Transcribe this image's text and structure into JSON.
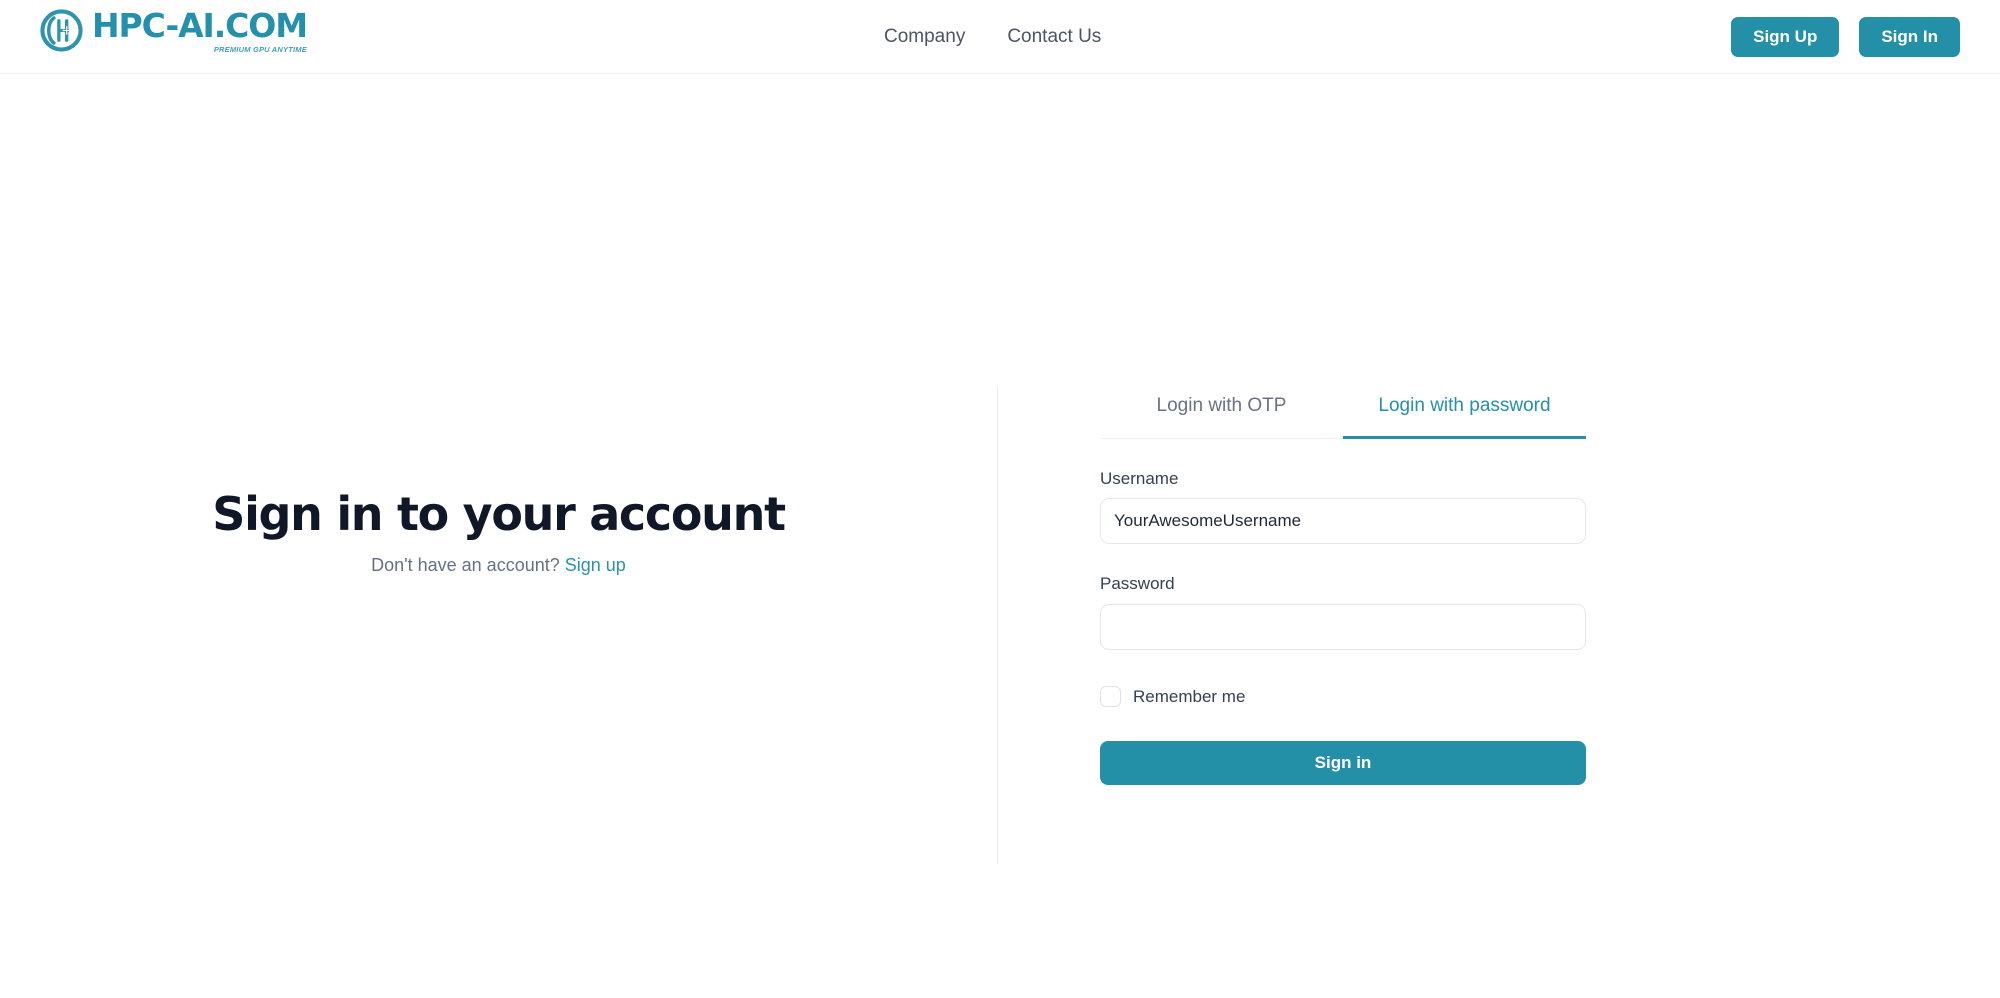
{
  "header": {
    "brand": {
      "wordmark": "HPC-AI.COM",
      "tagline": "PREMIUM GPU ANYTIME",
      "icon": "hpc-ai-circle-logo-icon",
      "color": "#2490ab"
    },
    "nav": [
      {
        "label": "Company"
      },
      {
        "label": "Contact Us"
      }
    ],
    "actions": {
      "sign_up_label": "Sign Up",
      "sign_in_label": "Sign In",
      "button_color": "#2490a8"
    }
  },
  "left_panel": {
    "title": "Sign in to your account",
    "subtext_prefix": "Don't have an account?",
    "signup_link_label": "Sign up",
    "link_color": "#2b92ac"
  },
  "login_form": {
    "tabs": [
      {
        "label": "Login with OTP",
        "active": false
      },
      {
        "label": "Login with password",
        "active": true
      }
    ],
    "active_tab_color": "#2490a8",
    "username": {
      "label": "Username",
      "value": "YourAwesomeUsername",
      "placeholder": "Username"
    },
    "password": {
      "label": "Password",
      "value": "",
      "placeholder": ""
    },
    "remember": {
      "label": "Remember me",
      "checked": false
    },
    "submit_label": "Sign in"
  }
}
